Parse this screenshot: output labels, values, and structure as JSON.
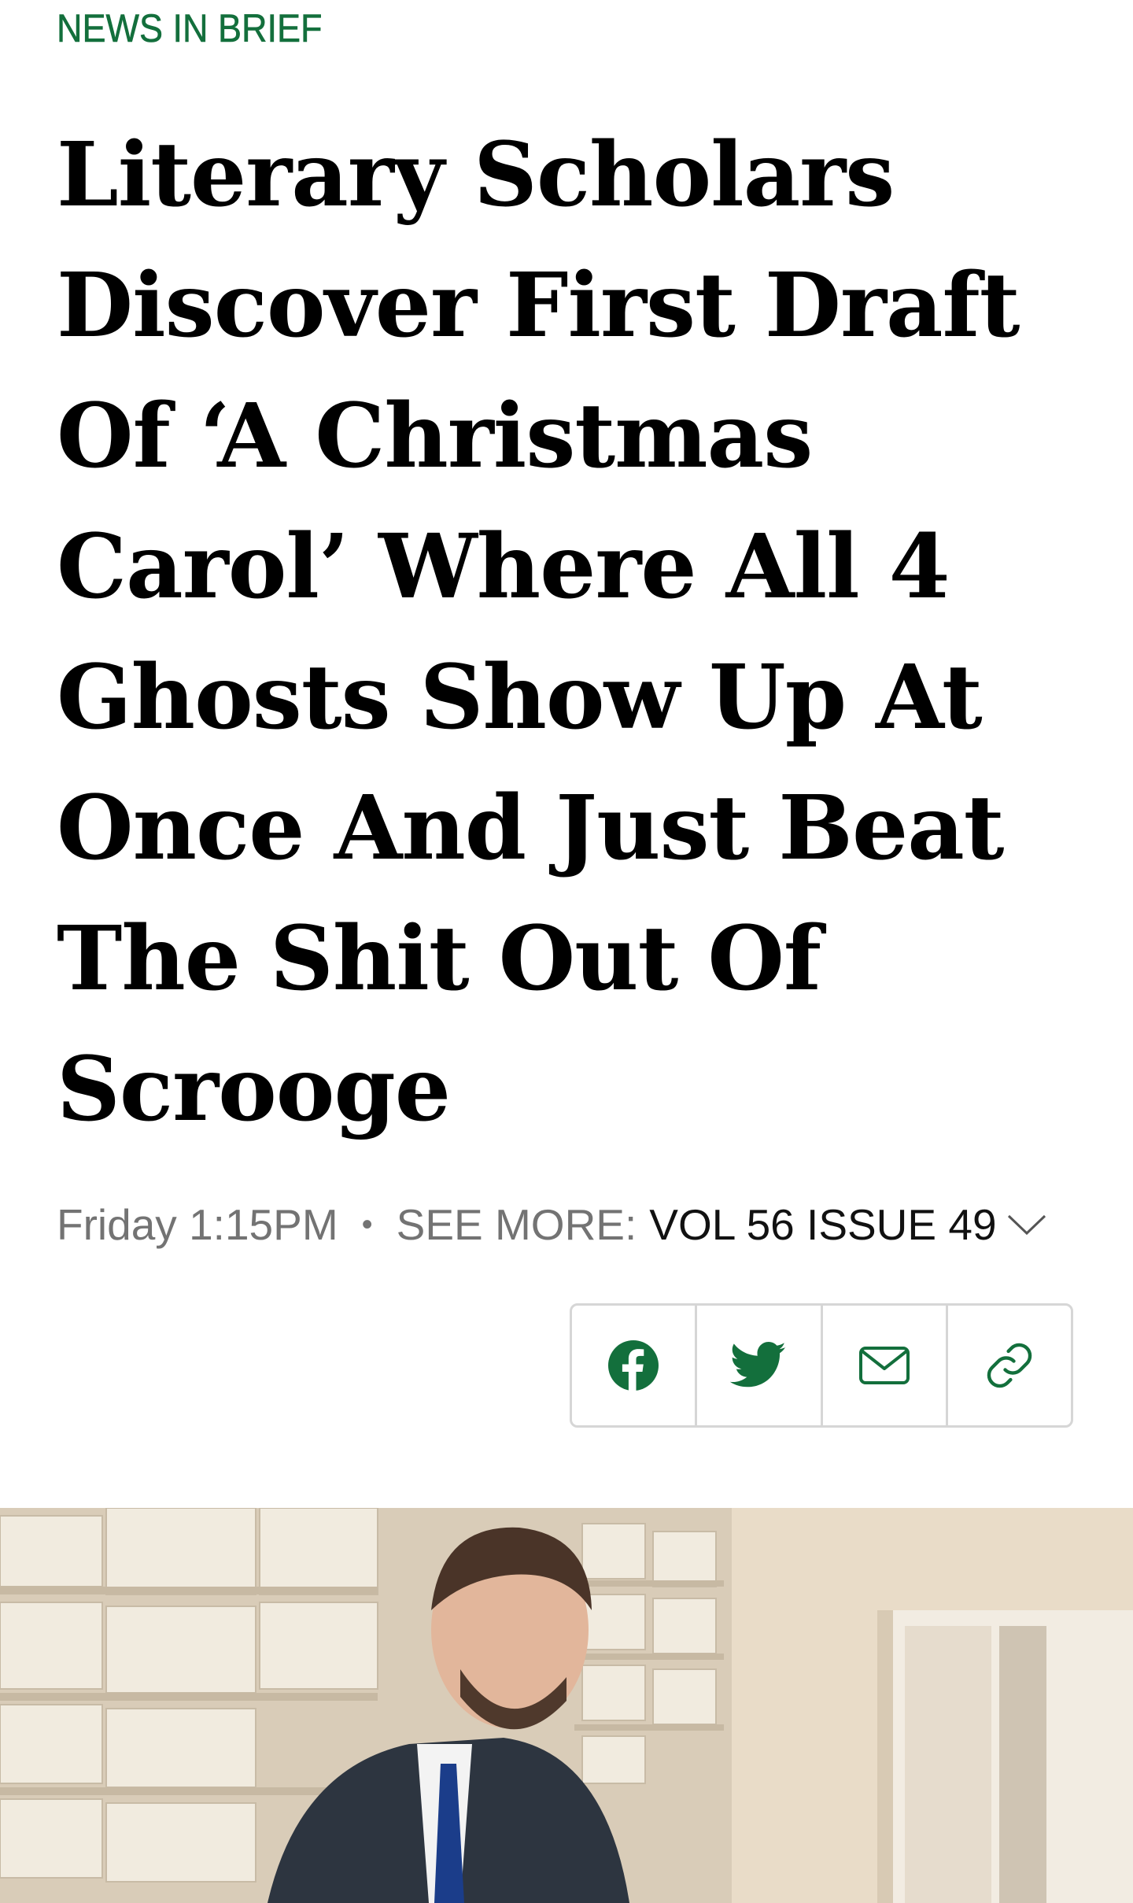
{
  "article": {
    "section": "NEWS IN BRIEF",
    "headline": "Literary Scholars Discover First Draft Of ‘A Christmas Carol’ Where All 4 Ghosts Show Up At Once And Just Beat The Shit Out Of Scrooge",
    "meta": {
      "date": "Friday 1:15PM",
      "separator": "•",
      "see_more_label": "SEE MORE:",
      "issue": "VOL 56 ISSUE 49"
    }
  },
  "share": {
    "buttons": [
      {
        "icon": "facebook-icon"
      },
      {
        "icon": "twitter-icon"
      },
      {
        "icon": "email-icon"
      },
      {
        "icon": "link-icon"
      }
    ]
  },
  "colors": {
    "section_green": "#136f3c",
    "meta_gray": "#737373",
    "border_gray": "#d6d6d6"
  }
}
